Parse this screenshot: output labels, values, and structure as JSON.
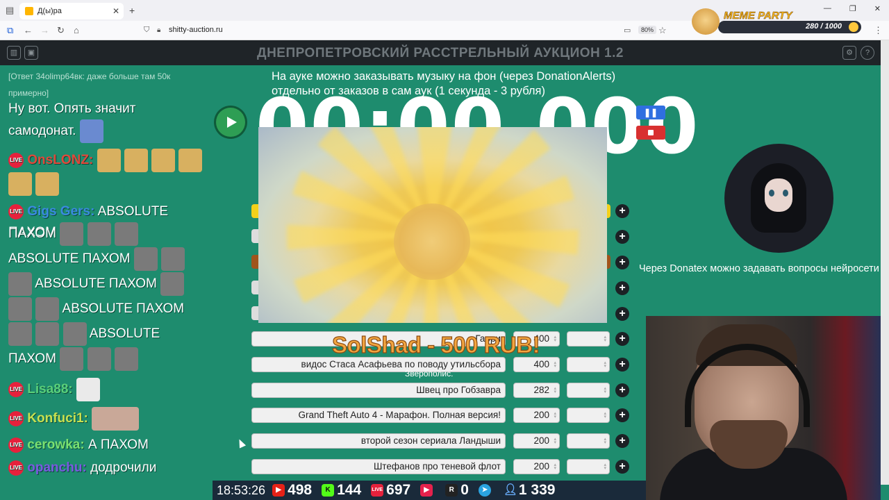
{
  "browser": {
    "tab_title": "Д(ы)ра",
    "url": "shitty-auction.ru",
    "zoom": "80%"
  },
  "overlay": {
    "meme_party_title": "MEME PARTY",
    "meme_party_progress": "280 / 1000"
  },
  "app": {
    "title": "ДНЕПРОПЕТРОВСКИЙ РАССТРЕЛЬНЫЙ АУКЦИОН 1.2",
    "music_note": "На ауке можно заказывать музыку на фон (через DonationAlerts) отдельно от заказов в сам аук (1 секунда - 3 рубля)",
    "timer": "00:00.000",
    "donation_alert": "SolShad - 500 RUB!",
    "donation_message": "Зверополис.",
    "donatex_note": "Через Donatex можно задавать вопросы нейросети"
  },
  "chat": {
    "system_line": "[Ответ 34olimp64вк: даже больше там 50к примерно]",
    "line1_text": "Ну вот. Опять значит самодонат.",
    "msg2_nick": "OnsLONZ:",
    "msg3_nick": "Gigs Gers:",
    "msg3_text_a": "ABSOLUTE ПАХОМ",
    "msg3_text_b": "ABSOLUTE ПАХОМ",
    "msg3_text_c": "ABSOLUTE ПАХОМ",
    "msg3_text_d": "ABSOLUTE ПАХОМ",
    "msg3_text_e": "ABSOLUTE",
    "msg3_text_f": "ПАХОМ",
    "msg4_nick": "Lisa88:",
    "msg5_nick": "Konfuci1:",
    "msg6_nick": "cerowka:",
    "msg6_text": "А ПАХОМ",
    "msg7_nick": "opanchu:",
    "msg7_text": "додрочили",
    "live_badge": "LIVE"
  },
  "lots": [
    {
      "name": "Гарри",
      "amount": "400"
    },
    {
      "name": "видос Стаса Асафьева по поводу утильсбора",
      "amount": "400"
    },
    {
      "name": "Швец про Гобзавра",
      "amount": "282"
    },
    {
      "name": "Grand Theft Auto 4 - Марафон. Полная версия!",
      "amount": "200"
    },
    {
      "name": "второй сезон сериала Ландыши",
      "amount": "200"
    },
    {
      "name": "Штефанов про теневой флот",
      "amount": "200"
    }
  ],
  "status": {
    "time": "18:53:26",
    "youtube": "498",
    "kick": "144",
    "vk_live": "697",
    "rutube_play": "",
    "r_count": "0",
    "viewers": "1 339"
  },
  "colors": {
    "background": "#1e8c6e",
    "header": "#1f2428",
    "donation": "#f2a540"
  }
}
